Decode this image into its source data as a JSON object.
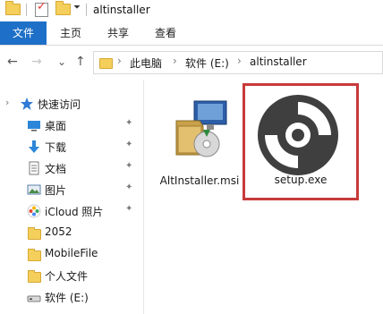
{
  "window": {
    "title": "altinstaller"
  },
  "ribbon": {
    "file_tab": "文件",
    "tabs": [
      "主页",
      "共享",
      "查看"
    ]
  },
  "address": {
    "breadcrumbs": [
      "此电脑",
      "软件 (E:)",
      "altinstaller"
    ]
  },
  "sidebar": {
    "quick_access_label": "快速访问",
    "items": [
      {
        "label": "桌面",
        "icon": "desktop-icon",
        "pinned": true
      },
      {
        "label": "下载",
        "icon": "download-icon",
        "pinned": true
      },
      {
        "label": "文档",
        "icon": "document-icon",
        "pinned": true
      },
      {
        "label": "图片",
        "icon": "picture-icon",
        "pinned": true
      },
      {
        "label": "iCloud 照片",
        "icon": "icloud-photos-icon",
        "pinned": true
      },
      {
        "label": "2052",
        "icon": "folder-icon",
        "pinned": false
      },
      {
        "label": "MobileFile",
        "icon": "folder-icon",
        "pinned": false
      },
      {
        "label": "个人文件",
        "icon": "folder-icon",
        "pinned": false
      },
      {
        "label": "软件 (E:)",
        "icon": "drive-icon",
        "pinned": false
      }
    ]
  },
  "files": [
    {
      "name": "AltInstaller.msi",
      "icon": "msi-installer-icon",
      "selected": false
    },
    {
      "name": "setup.exe",
      "icon": "disc-icon",
      "selected": true
    }
  ],
  "colors": {
    "accent": "#1e6fc7",
    "highlight": "#c83a3a",
    "folder": "#f4cf5b"
  },
  "icons": {
    "back": "←",
    "forward": "→",
    "recent": "⌄",
    "up": "↑",
    "chevron": "›",
    "pin": "📌",
    "expand": "›",
    "title_arrow": "⏷"
  }
}
